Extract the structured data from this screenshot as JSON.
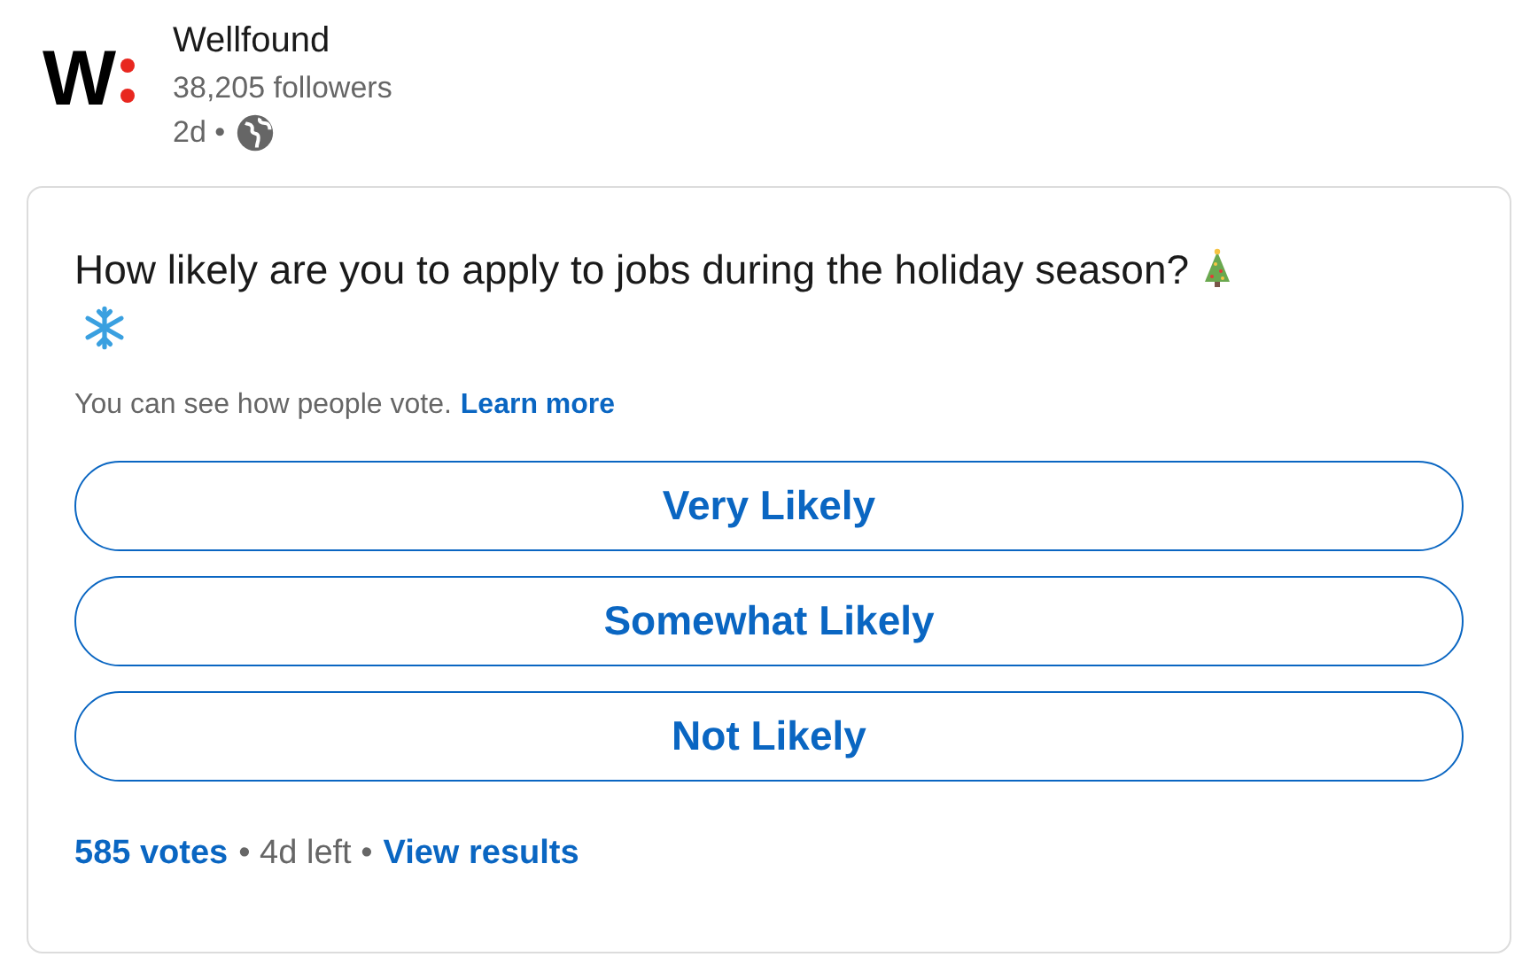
{
  "author": {
    "logo_text": "W",
    "name": "Wellfound",
    "followers": "38,205 followers",
    "age": "2d •"
  },
  "poll": {
    "question": "How likely are you to apply to jobs during the holiday season?",
    "note": "You can see how people vote.",
    "note_link": "Learn more",
    "options": [
      {
        "label": "Very Likely"
      },
      {
        "label": "Somewhat Likely"
      },
      {
        "label": "Not Likely"
      }
    ],
    "votes": "585 votes",
    "time_left": "• 4d left •",
    "results_link": "View results"
  }
}
